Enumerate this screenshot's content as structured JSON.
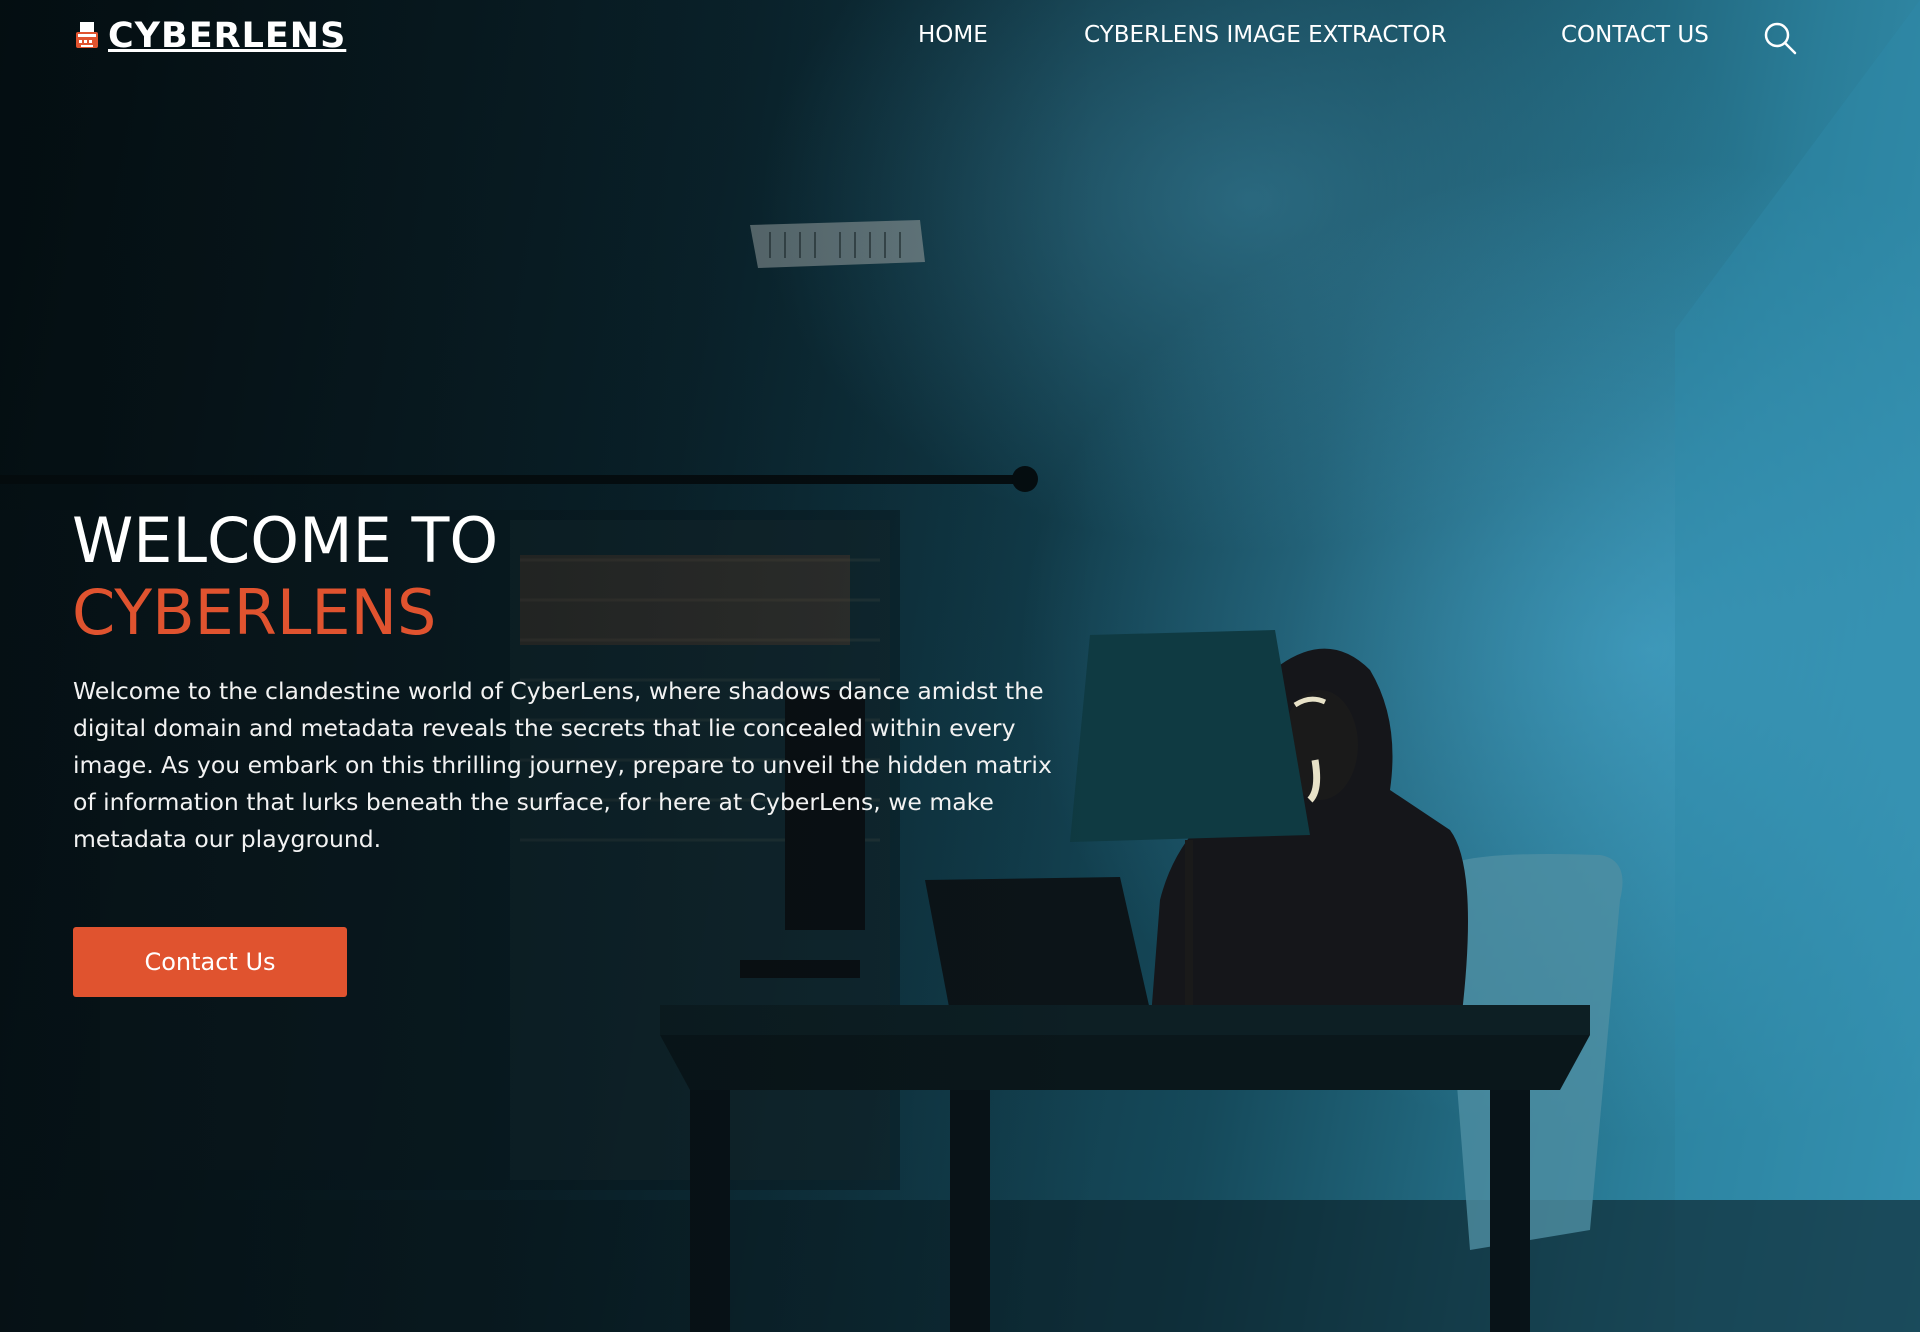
{
  "header": {
    "brand": "CYBERLENS",
    "brand_icon": "typewriter-icon",
    "nav": {
      "home": "HOME",
      "extractor": "CYBERLENS IMAGE EXTRACTOR",
      "contact": "CONTACT US"
    },
    "search_icon": "search-icon"
  },
  "hero": {
    "title_line1": "WELCOME TO",
    "title_line2": "CYBERLENS",
    "description": "Welcome to the clandestine world of CyberLens, where shadows dance amidst the digital domain and metadata reveals the secrets that lie concealed within every image. As you embark on this thrilling journey, prepare to unveil the hidden matrix of information that lurks beneath the surface, for here at CyberLens, we make metadata our playground.",
    "cta_label": "Contact Us",
    "background_image": "hooded figure in anonymous mask at desk with laptop and lamp in dark blue room"
  },
  "colors": {
    "accent": "#e0532f",
    "text": "#ffffff",
    "background_dark": "#061419",
    "background_light": "#3a98b8"
  }
}
